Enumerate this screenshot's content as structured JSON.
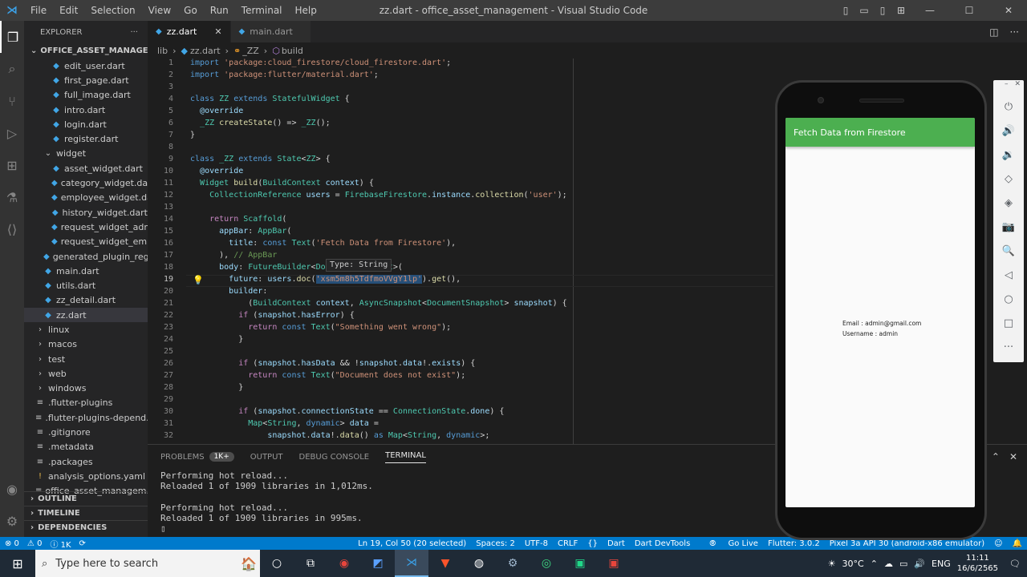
{
  "window": {
    "title": "zz.dart - office_asset_management - Visual Studio Code",
    "menu": [
      "File",
      "Edit",
      "Selection",
      "View",
      "Go",
      "Run",
      "Terminal",
      "Help"
    ]
  },
  "sidebar": {
    "header": "EXPLORER",
    "more": "···",
    "project": "OFFICE_ASSET_MANAGEMENT",
    "items": [
      {
        "label": "edit_user.dart",
        "type": "dart",
        "indent": 2
      },
      {
        "label": "first_page.dart",
        "type": "dart",
        "indent": 2
      },
      {
        "label": "full_image.dart",
        "type": "dart",
        "indent": 2
      },
      {
        "label": "intro.dart",
        "type": "dart",
        "indent": 2
      },
      {
        "label": "login.dart",
        "type": "dart",
        "indent": 2
      },
      {
        "label": "register.dart",
        "type": "dart",
        "indent": 2
      },
      {
        "label": "widget",
        "type": "folder-open",
        "indent": 1
      },
      {
        "label": "asset_widget.dart",
        "type": "dart",
        "indent": 2
      },
      {
        "label": "category_widget.dart",
        "type": "dart",
        "indent": 2
      },
      {
        "label": "employee_widget.dart",
        "type": "dart",
        "indent": 2
      },
      {
        "label": "history_widget.dart",
        "type": "dart",
        "indent": 2
      },
      {
        "label": "request_widget_adm...",
        "type": "dart",
        "indent": 2
      },
      {
        "label": "request_widget_emp...",
        "type": "dart",
        "indent": 2
      },
      {
        "label": "generated_plugin_reg...",
        "type": "dart",
        "indent": 1
      },
      {
        "label": "main.dart",
        "type": "dart",
        "indent": 1
      },
      {
        "label": "utils.dart",
        "type": "dart",
        "indent": 1
      },
      {
        "label": "zz_detail.dart",
        "type": "dart",
        "indent": 1
      },
      {
        "label": "zz.dart",
        "type": "dart",
        "indent": 1,
        "selected": true
      },
      {
        "label": "linux",
        "type": "folder",
        "indent": 0
      },
      {
        "label": "macos",
        "type": "folder",
        "indent": 0
      },
      {
        "label": "test",
        "type": "folder",
        "indent": 0
      },
      {
        "label": "web",
        "type": "folder",
        "indent": 0
      },
      {
        "label": "windows",
        "type": "folder",
        "indent": 0
      },
      {
        "label": ".flutter-plugins",
        "type": "file",
        "indent": 0
      },
      {
        "label": ".flutter-plugins-depend...",
        "type": "file",
        "indent": 0
      },
      {
        "label": ".gitignore",
        "type": "file",
        "indent": 0
      },
      {
        "label": ".metadata",
        "type": "file",
        "indent": 0
      },
      {
        "label": ".packages",
        "type": "file",
        "indent": 0
      },
      {
        "label": "analysis_options.yaml",
        "type": "excl",
        "indent": 0
      },
      {
        "label": "office_asset_managem...",
        "type": "file",
        "indent": 0
      }
    ],
    "sections": [
      "OUTLINE",
      "TIMELINE",
      "DEPENDENCIES"
    ]
  },
  "tabs": [
    {
      "label": "zz.dart",
      "active": true,
      "close": "✕"
    },
    {
      "label": "main.dart",
      "active": false
    }
  ],
  "breadcrumb": [
    "lib",
    "›",
    "zz.dart",
    "›",
    "_ZZ",
    "›",
    "build"
  ],
  "editor": {
    "current_line": 19,
    "hover_text": "Type: String",
    "lines": [
      {
        "n": "1",
        "t": [
          [
            "kw",
            "import "
          ],
          [
            "str",
            "'package:cloud_firestore/cloud_firestore.dart'"
          ],
          [
            "p",
            ";"
          ]
        ]
      },
      {
        "n": "2",
        "t": [
          [
            "kw",
            "import "
          ],
          [
            "str",
            "'package:flutter/material.dart'"
          ],
          [
            "p",
            ";"
          ]
        ]
      },
      {
        "n": "3",
        "t": []
      },
      {
        "n": "4",
        "t": [
          [
            "kw",
            "class "
          ],
          [
            "ty",
            "ZZ"
          ],
          [
            "kw",
            " extends "
          ],
          [
            "ty",
            "StatefulWidget"
          ],
          [
            "p",
            " {"
          ]
        ]
      },
      {
        "n": "5",
        "t": [
          [
            "p",
            "  "
          ],
          [
            "va",
            "@override"
          ]
        ]
      },
      {
        "n": "6",
        "t": [
          [
            "p",
            "  "
          ],
          [
            "ty",
            "_ZZ"
          ],
          [
            "p",
            " "
          ],
          [
            "fn",
            "createState"
          ],
          [
            "p",
            "() => "
          ],
          [
            "ty",
            "_ZZ"
          ],
          [
            "p",
            "();"
          ]
        ]
      },
      {
        "n": "7",
        "t": [
          [
            "p",
            "}"
          ]
        ]
      },
      {
        "n": "8",
        "t": []
      },
      {
        "n": "9",
        "t": [
          [
            "kw",
            "class "
          ],
          [
            "ty",
            "_ZZ"
          ],
          [
            "kw",
            " extends "
          ],
          [
            "ty",
            "State"
          ],
          [
            "p",
            "<"
          ],
          [
            "ty",
            "ZZ"
          ],
          [
            "p",
            "> {"
          ]
        ]
      },
      {
        "n": "10",
        "t": [
          [
            "p",
            "  "
          ],
          [
            "va",
            "@override"
          ]
        ]
      },
      {
        "n": "11",
        "t": [
          [
            "p",
            "  "
          ],
          [
            "ty",
            "Widget"
          ],
          [
            "p",
            " "
          ],
          [
            "fn",
            "build"
          ],
          [
            "p",
            "("
          ],
          [
            "ty",
            "BuildContext"
          ],
          [
            "p",
            " "
          ],
          [
            "va",
            "context"
          ],
          [
            "p",
            ") {"
          ]
        ]
      },
      {
        "n": "12",
        "t": [
          [
            "p",
            "    "
          ],
          [
            "ty",
            "CollectionReference"
          ],
          [
            "p",
            " "
          ],
          [
            "va",
            "users"
          ],
          [
            "p",
            " = "
          ],
          [
            "ty",
            "FirebaseFirestore"
          ],
          [
            "p",
            "."
          ],
          [
            "va",
            "instance"
          ],
          [
            "p",
            "."
          ],
          [
            "fn",
            "collection"
          ],
          [
            "p",
            "("
          ],
          [
            "str",
            "'user'"
          ],
          [
            "p",
            ");"
          ]
        ]
      },
      {
        "n": "13",
        "t": []
      },
      {
        "n": "14",
        "t": [
          [
            "p",
            "    "
          ],
          [
            "ctl",
            "return "
          ],
          [
            "ty",
            "Scaffold"
          ],
          [
            "p",
            "("
          ]
        ]
      },
      {
        "n": "15",
        "t": [
          [
            "p",
            "      "
          ],
          [
            "va",
            "appBar"
          ],
          [
            "p",
            ": "
          ],
          [
            "ty",
            "AppBar"
          ],
          [
            "p",
            "("
          ]
        ]
      },
      {
        "n": "16",
        "t": [
          [
            "p",
            "        "
          ],
          [
            "va",
            "title"
          ],
          [
            "p",
            ": "
          ],
          [
            "kw",
            "const "
          ],
          [
            "ty",
            "Text"
          ],
          [
            "p",
            "("
          ],
          [
            "str",
            "'Fetch Data from Firestore'"
          ],
          [
            "p",
            "),"
          ]
        ]
      },
      {
        "n": "17",
        "t": [
          [
            "p",
            "      ), "
          ],
          [
            "cm",
            "// AppBar"
          ]
        ]
      },
      {
        "n": "18",
        "t": [
          [
            "p",
            "      "
          ],
          [
            "va",
            "body"
          ],
          [
            "p",
            ": "
          ],
          [
            "ty",
            "FutureBuilder"
          ],
          [
            "p",
            "<"
          ],
          [
            "ty",
            "DocumentSnapshot"
          ],
          [
            "p",
            ">("
          ]
        ]
      },
      {
        "n": "19",
        "t": [
          [
            "p",
            "        "
          ],
          [
            "va",
            "future"
          ],
          [
            "p",
            ": "
          ],
          [
            "va",
            "users"
          ],
          [
            "p",
            "."
          ],
          [
            "fn",
            "doc"
          ],
          [
            "p",
            "("
          ],
          [
            "sel",
            "'xsm5m8h5TdfmoVVgY1lp'"
          ],
          [
            "p",
            ")."
          ],
          [
            "fn",
            "get"
          ],
          [
            "p",
            "(),"
          ]
        ]
      },
      {
        "n": "20",
        "t": [
          [
            "p",
            "        "
          ],
          [
            "va",
            "builder"
          ],
          [
            "p",
            ":"
          ]
        ]
      },
      {
        "n": "21",
        "t": [
          [
            "p",
            "            ("
          ],
          [
            "ty",
            "BuildContext"
          ],
          [
            "p",
            " "
          ],
          [
            "va",
            "context"
          ],
          [
            "p",
            ", "
          ],
          [
            "ty",
            "AsyncSnapshot"
          ],
          [
            "p",
            "<"
          ],
          [
            "ty",
            "DocumentSnapshot"
          ],
          [
            "p",
            "> "
          ],
          [
            "va",
            "snapshot"
          ],
          [
            "p",
            ") {"
          ]
        ]
      },
      {
        "n": "22",
        "t": [
          [
            "p",
            "          "
          ],
          [
            "ctl",
            "if "
          ],
          [
            "p",
            "("
          ],
          [
            "va",
            "snapshot"
          ],
          [
            "p",
            "."
          ],
          [
            "va",
            "hasError"
          ],
          [
            "p",
            ") {"
          ]
        ]
      },
      {
        "n": "23",
        "t": [
          [
            "p",
            "            "
          ],
          [
            "ctl",
            "return "
          ],
          [
            "kw",
            "const "
          ],
          [
            "ty",
            "Text"
          ],
          [
            "p",
            "("
          ],
          [
            "str",
            "\"Something went wrong\""
          ],
          [
            "p",
            ");"
          ]
        ]
      },
      {
        "n": "24",
        "t": [
          [
            "p",
            "          }"
          ]
        ]
      },
      {
        "n": "25",
        "t": []
      },
      {
        "n": "26",
        "t": [
          [
            "p",
            "          "
          ],
          [
            "ctl",
            "if "
          ],
          [
            "p",
            "("
          ],
          [
            "va",
            "snapshot"
          ],
          [
            "p",
            "."
          ],
          [
            "va",
            "hasData"
          ],
          [
            "p",
            " && !"
          ],
          [
            "va",
            "snapshot"
          ],
          [
            "p",
            "."
          ],
          [
            "va",
            "data"
          ],
          [
            "p",
            "!."
          ],
          [
            "va",
            "exists"
          ],
          [
            "p",
            ") {"
          ]
        ]
      },
      {
        "n": "27",
        "t": [
          [
            "p",
            "            "
          ],
          [
            "ctl",
            "return "
          ],
          [
            "kw",
            "const "
          ],
          [
            "ty",
            "Text"
          ],
          [
            "p",
            "("
          ],
          [
            "str",
            "\"Document does not exist\""
          ],
          [
            "p",
            ");"
          ]
        ]
      },
      {
        "n": "28",
        "t": [
          [
            "p",
            "          }"
          ]
        ]
      },
      {
        "n": "29",
        "t": []
      },
      {
        "n": "30",
        "t": [
          [
            "p",
            "          "
          ],
          [
            "ctl",
            "if "
          ],
          [
            "p",
            "("
          ],
          [
            "va",
            "snapshot"
          ],
          [
            "p",
            "."
          ],
          [
            "va",
            "connectionState"
          ],
          [
            "p",
            " == "
          ],
          [
            "ty",
            "ConnectionState"
          ],
          [
            "p",
            "."
          ],
          [
            "va",
            "done"
          ],
          [
            "p",
            ") {"
          ]
        ]
      },
      {
        "n": "31",
        "t": [
          [
            "p",
            "            "
          ],
          [
            "ty",
            "Map"
          ],
          [
            "p",
            "<"
          ],
          [
            "ty",
            "String"
          ],
          [
            "p",
            ", "
          ],
          [
            "kw",
            "dynamic"
          ],
          [
            "p",
            "> "
          ],
          [
            "va",
            "data"
          ],
          [
            "p",
            " ="
          ]
        ]
      },
      {
        "n": "32",
        "t": [
          [
            "p",
            "                "
          ],
          [
            "va",
            "snapshot"
          ],
          [
            "p",
            "."
          ],
          [
            "va",
            "data"
          ],
          [
            "p",
            "!."
          ],
          [
            "fn",
            "data"
          ],
          [
            "p",
            "() "
          ],
          [
            "kw",
            "as "
          ],
          [
            "ty",
            "Map"
          ],
          [
            "p",
            "<"
          ],
          [
            "ty",
            "String"
          ],
          [
            "p",
            ", "
          ],
          [
            "kw",
            "dynamic"
          ],
          [
            "p",
            ">;"
          ]
        ]
      }
    ]
  },
  "panel": {
    "tabs": [
      "PROBLEMS",
      "1K+",
      "OUTPUT",
      "DEBUG CONSOLE",
      "TERMINAL"
    ],
    "terminal": "Performing hot reload...\nReloaded 1 of 1909 libraries in 1,012ms.\n\nPerforming hot reload...\nReloaded 1 of 1909 libraries in 995ms.\n▯"
  },
  "status": {
    "left": [
      "⊗ 0",
      "⚠ 0",
      "ⓘ 1K",
      "⟳"
    ],
    "right": [
      "Ln 19, Col 50 (20 selected)",
      "Spaces: 2",
      "UTF-8",
      "CRLF",
      "Dart",
      "Dart DevTools",
      "Go Live",
      "Flutter: 3.0.2",
      "Pixel 3a API 30 (android-x86 emulator)"
    ]
  },
  "emulator": {
    "appbar_title": "Fetch Data from Firestore",
    "email_line": "Email : admin@gmail.com",
    "username_line": "Username : admin",
    "controls": [
      "⏻",
      "🔊",
      "🔉",
      "◇",
      "◈",
      "📷",
      "🔍",
      "◁",
      "○",
      "□",
      "···"
    ]
  },
  "taskbar": {
    "search_placeholder": "Type here to search",
    "weather": "30°C",
    "lang": "ENG",
    "time": "11:11",
    "date": "16/6/2565",
    "notif": "🗨"
  },
  "colors": {
    "accent": "#007acc",
    "appbar_green": "#4caf50",
    "dart_blue": "#41a6e6"
  }
}
